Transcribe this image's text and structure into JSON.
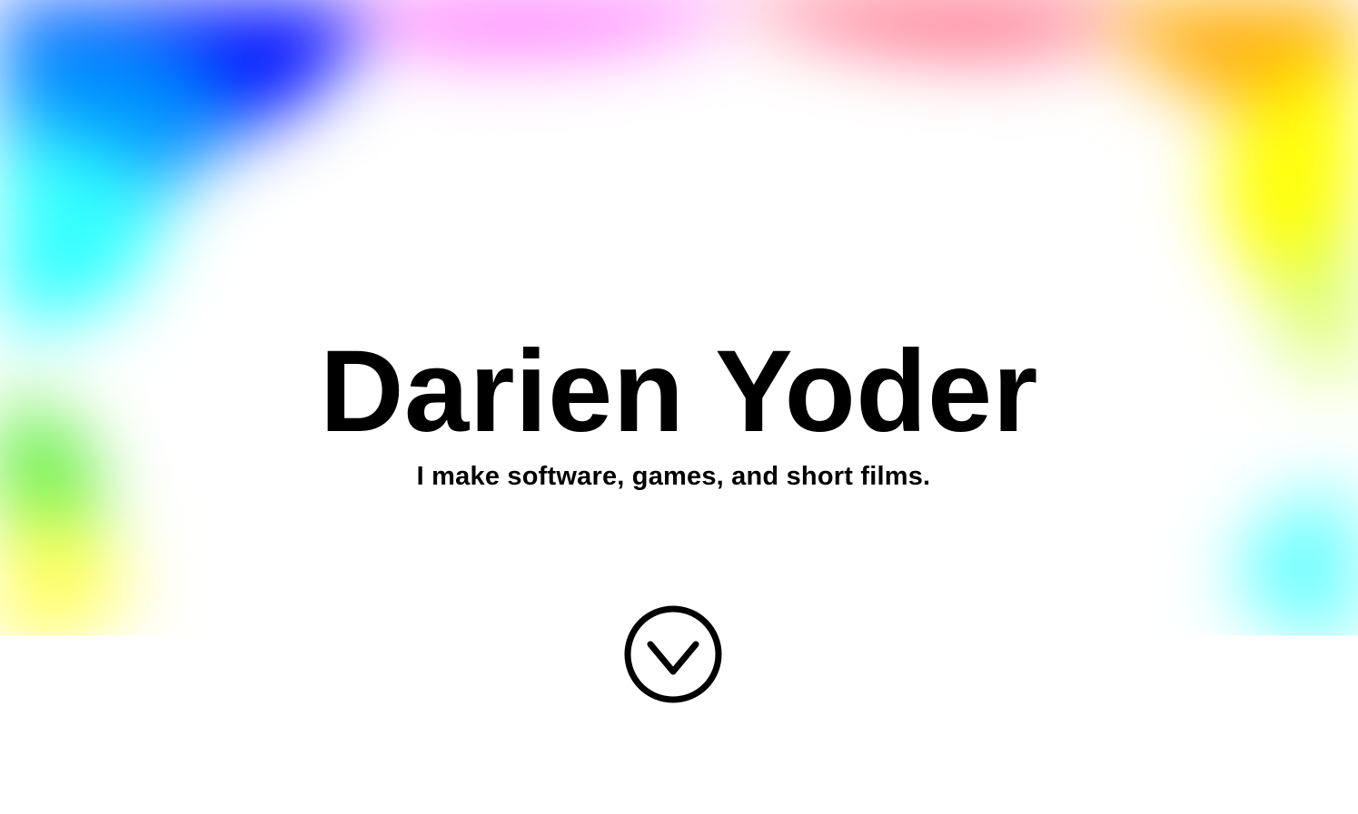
{
  "hero": {
    "title": "Darien Yoder",
    "subtitle": "I make software, games, and short films."
  },
  "scroll_button": {
    "icon": "chevron-down-circle-icon"
  },
  "colors": {
    "text": "#000000",
    "background": "#ffffff",
    "gradient": [
      "#0000ff",
      "#00a0ff",
      "#00ffff",
      "#66ff33",
      "#ffff00",
      "#ffb000",
      "#ff5a6e",
      "#ff66ff",
      "#66ffff"
    ]
  }
}
